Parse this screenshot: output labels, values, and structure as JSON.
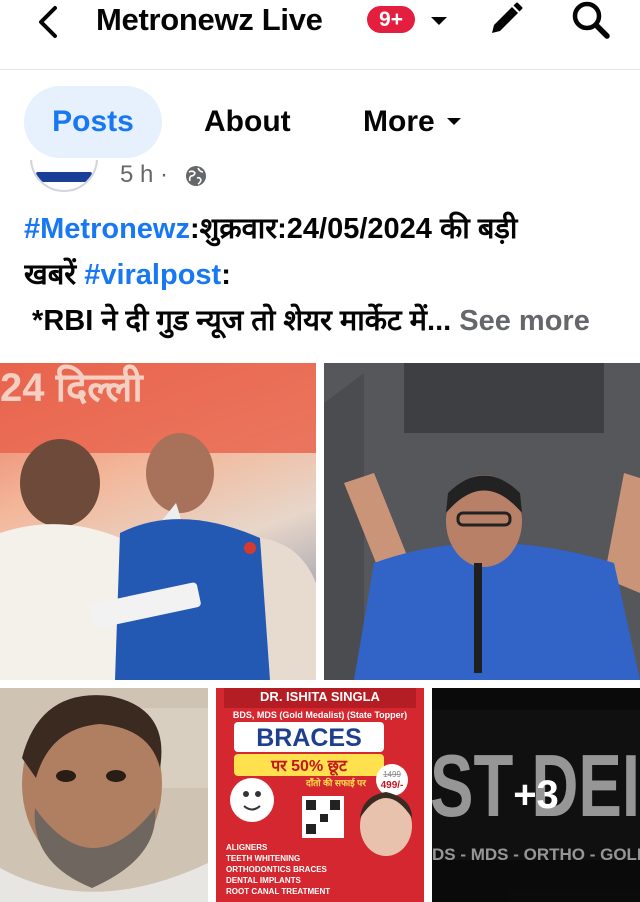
{
  "header": {
    "title": "Metronewz Live",
    "notification_badge": "9+",
    "icons": [
      "back-arrow-icon",
      "caret-down-icon",
      "pencil-icon",
      "search-icon"
    ]
  },
  "tabs": [
    {
      "label": "Posts",
      "active": true
    },
    {
      "label": "About",
      "active": false
    },
    {
      "label": "More",
      "active": false
    }
  ],
  "post": {
    "time": "5 h ·",
    "audience_icon": "globe-icon",
    "text": {
      "hashtag1": "#Metronewz",
      "line1_rest": ":शुक्रवार:24/05/2024 की बड़ी",
      "line2_prefix": "खबरें ",
      "hashtag2": "#viralpost",
      "line2_suffix": ":",
      "line3": " *RBI ने दी गुड न्यूज तो शेयर मार्केट में... ",
      "see_more": "See more"
    },
    "photos": {
      "p1_caption": "24 दिल्ली",
      "p4_title": "DR. ISHITA SINGLA",
      "p4_subtitle": "BDS, MDS (Gold Medalist) (State Topper)",
      "p4_heading": "BRACES",
      "p4_offer": "पर 50% छूट",
      "p4_price_old": "1499",
      "p4_price_new": "499/-",
      "p4_clean": "दाँतो की सफाई पर",
      "p4_list": [
        "ALIGNERS",
        "TEETH WHITENING",
        "ORTHODONTICS BRACES",
        "DENTAL IMPLANTS",
        "ROOT CANAL TREATMENT"
      ],
      "p5_banner_top": "ST DEI",
      "p5_banner_bottom": "DS - MDS - ORTHO - GOLD M",
      "more_count": "+3"
    }
  },
  "colors": {
    "accent": "#1877f2",
    "badge": "#e41e3f",
    "tab_active_bg": "#e7f0fd",
    "secondary_text": "#65676b"
  }
}
